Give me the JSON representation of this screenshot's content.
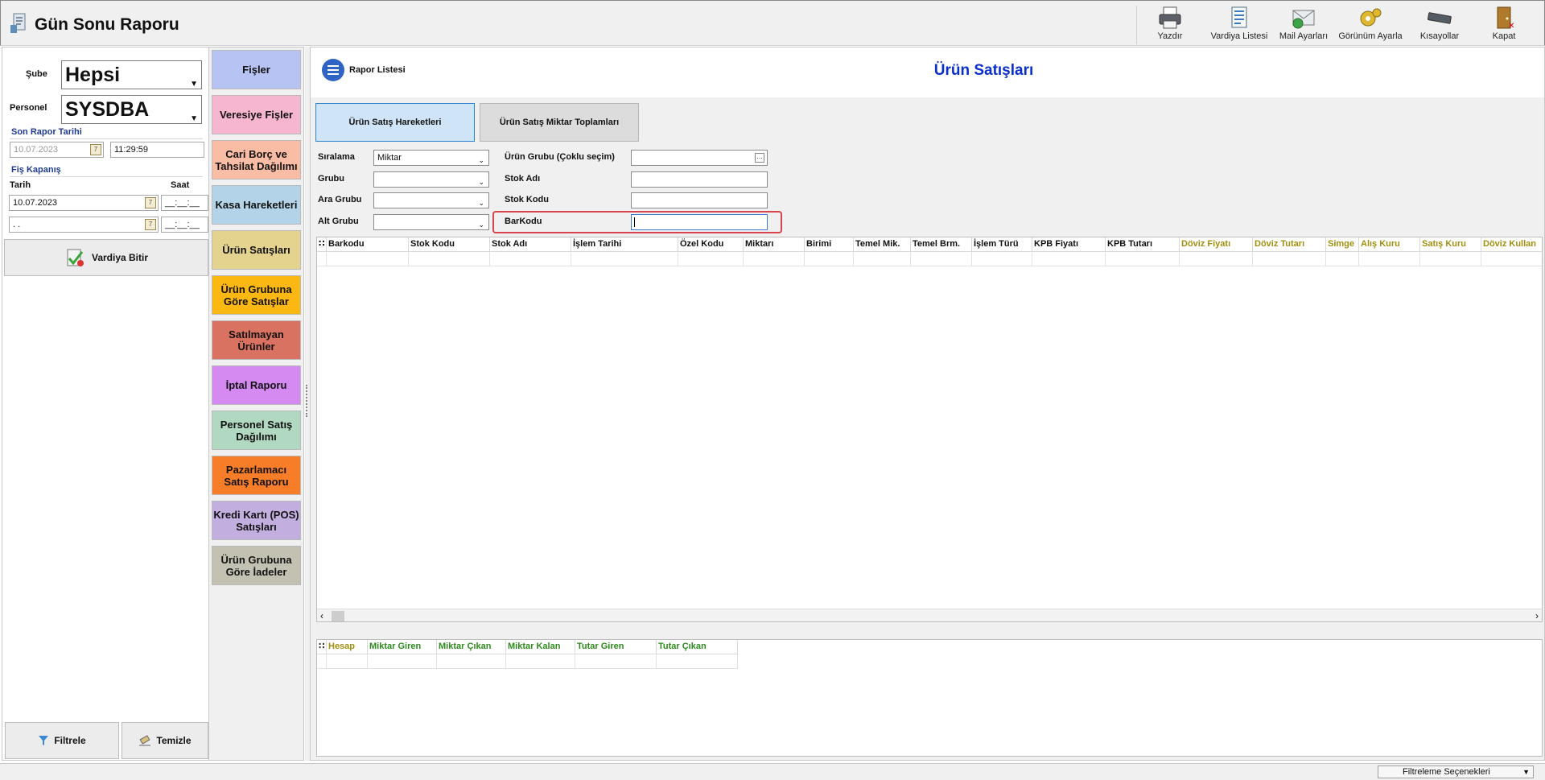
{
  "window": {
    "title": "Gün Sonu Raporu"
  },
  "toolbar": {
    "items": [
      {
        "label": "Yazdır",
        "icon": "printer-icon"
      },
      {
        "label": "Vardiya Listesi",
        "icon": "list-document-icon"
      },
      {
        "label": "Mail Ayarları",
        "icon": "mail-settings-icon"
      },
      {
        "label": "Görünüm Ayarla",
        "icon": "view-settings-icon"
      },
      {
        "label": "Kısayollar",
        "icon": "keyboard-icon"
      },
      {
        "label": "Kapat",
        "icon": "exit-door-icon"
      }
    ]
  },
  "left": {
    "sube_label": "Şube",
    "sube_value": "Hepsi",
    "personel_label": "Personel",
    "personel_value": "SYSDBA",
    "son_rapor_label": "Son Rapor Tarihi",
    "son_rapor_date": "10.07.2023",
    "son_rapor_time": "11:29:59",
    "fis_kapanis_label": "Fiş Kapanış",
    "tarih_label": "Tarih",
    "saat_label": "Saat",
    "tarih_value": "10.07.2023",
    "saat_value": "__:__:__",
    "tarih2_value": ". .",
    "saat2_value": "__:__:__",
    "vardiya_bitir": "Vardiya Bitir",
    "filtrele": "Filtrele",
    "temizle": "Temizle"
  },
  "menu": {
    "items": [
      {
        "label": "Fişler",
        "color": "#b7c3f3"
      },
      {
        "label": "Veresiye Fişler",
        "color": "#f6b6d0"
      },
      {
        "label": "Cari Borç ve Tahsilat Dağılımı",
        "color": "#f9bca4"
      },
      {
        "label": "Kasa Hareketleri",
        "color": "#b3d4e8"
      },
      {
        "label": "Ürün Satışları",
        "color": "#e3d38e"
      },
      {
        "label": "Ürün Grubuna Göre Satışlar",
        "color": "#fbb712"
      },
      {
        "label": "Satılmayan Ürünler",
        "color": "#d97260"
      },
      {
        "label": "İptal Raporu",
        "color": "#d48af0"
      },
      {
        "label": "Personel Satış Dağılımı",
        "color": "#b1d8c1"
      },
      {
        "label": "Pazarlamacı Satış Raporu",
        "color": "#f77d29"
      },
      {
        "label": "Kredi Kartı (POS) Satışları",
        "color": "#c2aedf"
      },
      {
        "label": "Ürün Grubuna Göre İadeler",
        "color": "#c3c2b2"
      }
    ]
  },
  "main": {
    "report_list": "Rapor Listesi",
    "title": "Ürün Satışları",
    "tabs": [
      "Ürün Satış Hareketleri",
      "Ürün Satış Miktar Toplamları"
    ],
    "filters": {
      "siralama_label": "Sıralama",
      "siralama_value": "Miktar",
      "grubu_label": "Grubu",
      "ara_grubu_label": "Ara Grubu",
      "alt_grubu_label": "Alt Grubu",
      "urun_grubu_label": "Ürün Grubu (Çoklu seçim)",
      "stok_adi_label": "Stok Adı",
      "stok_kodu_label": "Stok Kodu",
      "barkodu_label": "BarKodu"
    },
    "grid_columns": [
      {
        "label": "Barkodu",
        "tone": "normal"
      },
      {
        "label": "Stok Kodu",
        "tone": "normal"
      },
      {
        "label": "Stok Adı",
        "tone": "normal"
      },
      {
        "label": "İşlem Tarihi",
        "tone": "normal"
      },
      {
        "label": "Özel Kodu",
        "tone": "normal"
      },
      {
        "label": "Miktarı",
        "tone": "normal"
      },
      {
        "label": "Birimi",
        "tone": "normal"
      },
      {
        "label": "Temel Mik.",
        "tone": "normal"
      },
      {
        "label": "Temel Brm.",
        "tone": "normal"
      },
      {
        "label": "İşlem Türü",
        "tone": "normal"
      },
      {
        "label": "KPB Fiyatı",
        "tone": "normal"
      },
      {
        "label": "KPB Tutarı",
        "tone": "normal"
      },
      {
        "label": "Döviz Fiyatı",
        "tone": "olive"
      },
      {
        "label": "Döviz Tutarı",
        "tone": "olive"
      },
      {
        "label": "Simge",
        "tone": "olive"
      },
      {
        "label": "Alış Kuru",
        "tone": "olive"
      },
      {
        "label": "Satış Kuru",
        "tone": "olive"
      },
      {
        "label": "Döviz Kullan",
        "tone": "olive"
      }
    ],
    "summary_columns": [
      {
        "label": "Hesap",
        "tone": "olive"
      },
      {
        "label": "Miktar Giren",
        "tone": "green"
      },
      {
        "label": "Miktar Çıkan",
        "tone": "green"
      },
      {
        "label": "Miktar Kalan",
        "tone": "green"
      },
      {
        "label": "Tutar Giren",
        "tone": "green"
      },
      {
        "label": "Tutar Çıkan",
        "tone": "green"
      }
    ]
  },
  "status": {
    "filter_options": "Filtreleme Seçenekleri"
  }
}
